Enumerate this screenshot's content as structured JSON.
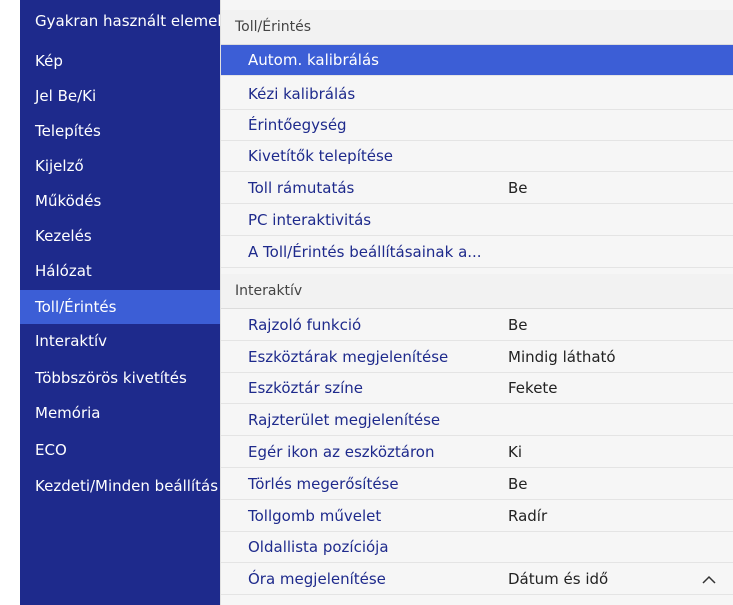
{
  "sidebar": {
    "items": [
      {
        "label": "Gyakran használt elemek",
        "active": false
      },
      {
        "label": "Kép",
        "active": false
      },
      {
        "label": "Jel Be/Ki",
        "active": false
      },
      {
        "label": "Telepítés",
        "active": false
      },
      {
        "label": "Kijelző",
        "active": false
      },
      {
        "label": "Működés",
        "active": false
      },
      {
        "label": "Kezelés",
        "active": false
      },
      {
        "label": "Hálózat",
        "active": false
      },
      {
        "label": "Toll/Érintés",
        "active": true
      },
      {
        "label": "Interaktív",
        "active": false
      },
      {
        "label": "Többszörös kivetítés",
        "active": false
      },
      {
        "label": "Memória",
        "active": false
      },
      {
        "label": "ECO",
        "active": false
      },
      {
        "label": "Kezdeti/Minden beállítás",
        "active": false
      }
    ]
  },
  "main": {
    "section1": {
      "title": "Toll/Érintés",
      "rows": [
        {
          "label": "Autom. kalibrálás",
          "value": "",
          "active": true
        },
        {
          "label": "Kézi kalibrálás",
          "value": ""
        },
        {
          "label": "Érintőegység",
          "value": ""
        },
        {
          "label": "Kivetítők telepítése",
          "value": ""
        },
        {
          "label": "Toll rámutatás",
          "value": "Be"
        },
        {
          "label": "PC interaktivitás",
          "value": ""
        },
        {
          "label": "A Toll/Érintés beállításainak a...",
          "value": ""
        }
      ]
    },
    "section2": {
      "title": "Interaktív",
      "rows": [
        {
          "label": "Rajzoló funkció",
          "value": "Be"
        },
        {
          "label": "Eszköztárak megjelenítése",
          "value": "Mindig látható"
        },
        {
          "label": "Eszköztár színe",
          "value": "Fekete"
        },
        {
          "label": "Rajzterület megjelenítése",
          "value": ""
        },
        {
          "label": "Egér ikon az eszköztáron",
          "value": "Ki"
        },
        {
          "label": "Törlés megerősítése",
          "value": "Be"
        },
        {
          "label": "Tollgomb művelet",
          "value": "Radír"
        },
        {
          "label": "Oldallista pozíciója",
          "value": ""
        },
        {
          "label": "Óra megjelenítése",
          "value": "Dátum és idő"
        }
      ]
    }
  },
  "icons": {
    "scroll": "chevron-up-icon"
  },
  "colors": {
    "sidebar_bg": "#1e2a8c",
    "highlight": "#3c5ed6",
    "label_text": "#1e2a8c"
  }
}
